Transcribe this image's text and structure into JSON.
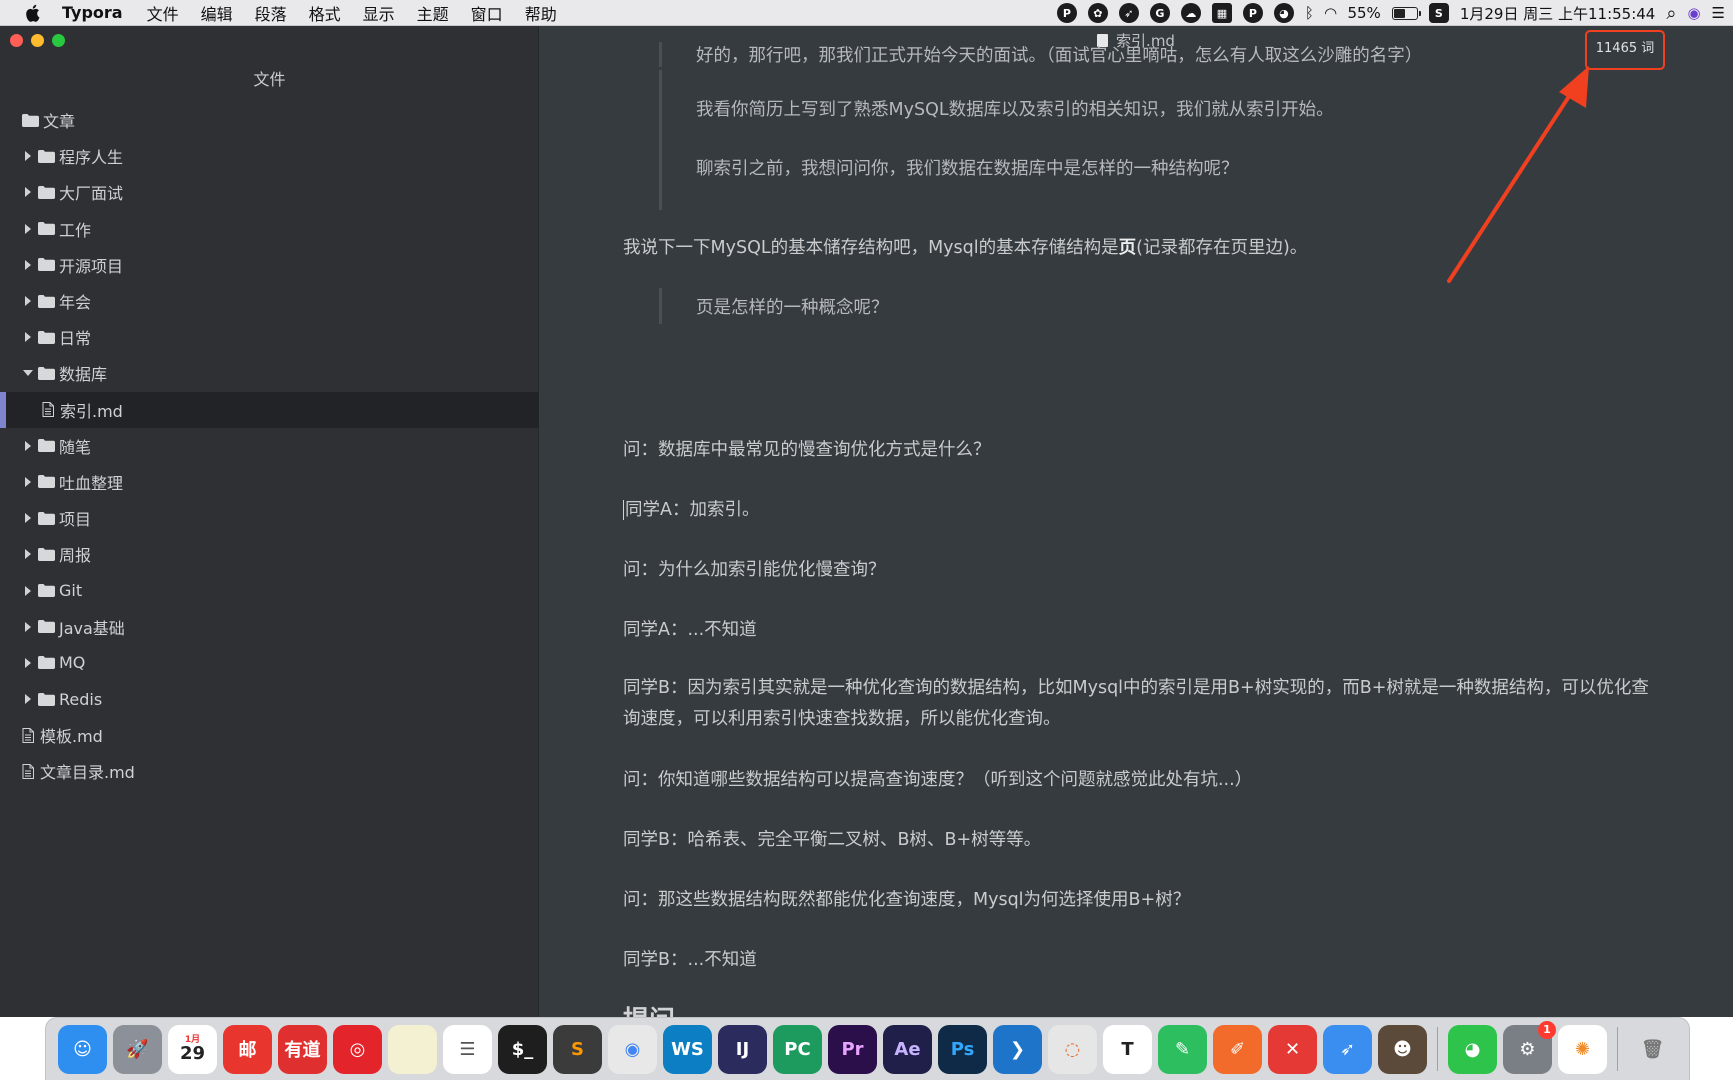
{
  "menubar": {
    "app_name": "Typora",
    "menus": [
      "文件",
      "编辑",
      "段落",
      "格式",
      "显示",
      "主题",
      "窗口",
      "帮助"
    ],
    "status_icons": [
      {
        "name": "pp-icon",
        "glyph": "P"
      },
      {
        "name": "swirl-icon",
        "glyph": "✿"
      },
      {
        "name": "rocket-status-icon",
        "glyph": "➶"
      },
      {
        "name": "grammarly-icon",
        "glyph": "G"
      },
      {
        "name": "cloud-icon",
        "glyph": "☁"
      },
      {
        "name": "grid-icon",
        "glyph": "▦"
      },
      {
        "name": "p-badge-icon",
        "glyph": "P"
      },
      {
        "name": "wechat-status-icon",
        "glyph": "◕"
      },
      {
        "name": "bluetooth-icon",
        "glyph": "ᛒ"
      },
      {
        "name": "wifi-icon",
        "glyph": "◠"
      }
    ],
    "battery_percent": "55%",
    "battery_level": 0.55,
    "scrivener_glyph": "S",
    "datetime": "1月29日 周三 上午11:55:44",
    "search_glyph": "⌕",
    "siri_glyph": "◉",
    "menu_list_glyph": "☰"
  },
  "sidebar": {
    "title": "文件",
    "tree": [
      {
        "label": "文章",
        "type": "folder",
        "depth": 0,
        "state": "none"
      },
      {
        "label": "程序人生",
        "type": "folder",
        "depth": 1,
        "state": "collapsed"
      },
      {
        "label": "大厂面试",
        "type": "folder",
        "depth": 1,
        "state": "collapsed"
      },
      {
        "label": "工作",
        "type": "folder",
        "depth": 1,
        "state": "collapsed"
      },
      {
        "label": "开源项目",
        "type": "folder",
        "depth": 1,
        "state": "collapsed"
      },
      {
        "label": "年会",
        "type": "folder",
        "depth": 1,
        "state": "collapsed"
      },
      {
        "label": "日常",
        "type": "folder",
        "depth": 1,
        "state": "collapsed"
      },
      {
        "label": "数据库",
        "type": "folder",
        "depth": 1,
        "state": "expanded"
      },
      {
        "label": "索引.md",
        "type": "file",
        "depth": 2,
        "state": "none",
        "selected": true
      },
      {
        "label": "随笔",
        "type": "folder",
        "depth": 1,
        "state": "collapsed"
      },
      {
        "label": "吐血整理",
        "type": "folder",
        "depth": 1,
        "state": "collapsed"
      },
      {
        "label": "项目",
        "type": "folder",
        "depth": 1,
        "state": "collapsed"
      },
      {
        "label": "周报",
        "type": "folder",
        "depth": 1,
        "state": "collapsed"
      },
      {
        "label": "Git",
        "type": "folder",
        "depth": 1,
        "state": "collapsed"
      },
      {
        "label": "Java基础",
        "type": "folder",
        "depth": 1,
        "state": "collapsed"
      },
      {
        "label": "MQ",
        "type": "folder",
        "depth": 1,
        "state": "collapsed"
      },
      {
        "label": "Redis",
        "type": "folder",
        "depth": 1,
        "state": "collapsed"
      },
      {
        "label": "模板.md",
        "type": "file",
        "depth": 1,
        "state": "none"
      },
      {
        "label": "文章目录.md",
        "type": "file",
        "depth": 1,
        "state": "none"
      }
    ]
  },
  "editor": {
    "doc_title": "索引.md",
    "word_count": "11465 词",
    "quote_1": "好的，那行吧，那我们正式开始今天的面试。（面试官心里嘀咕，怎么有人取这么沙雕的名字）",
    "quote_2": "我看你简历上写到了熟悉MySQL数据库以及索引的相关知识，我们就从索引开始。",
    "quote_3": "聊索引之前，我想问问你，我们数据在数据库中是怎样的一种结构呢？",
    "para_storage_a": "我说下一下MySQL的基本储存结构吧，Mysql的基本存储结构是",
    "para_storage_bold": "页",
    "para_storage_b": "(记录都存在页里边)。",
    "quote_4": "页是怎样的一种概念呢？",
    "q1": "问：数据库中最常见的慢查询优化方式是什么？",
    "a1": "同学A：加索引。",
    "q2": "问：为什么加索引能优化慢查询？",
    "a2": "同学A：...不知道",
    "b1": "同学B：因为索引其实就是一种优化查询的数据结构，比如Mysql中的索引是用B+树实现的，而B+树就是一种数据结构，可以优化查询速度，可以利用索引快速查找数据，所以能优化查询。",
    "q3": "问：你知道哪些数据结构可以提高查询速度？（听到这个问题就感觉此处有坑...）",
    "b2": "同学B：哈希表、完全平衡二叉树、B树、B+树等等。",
    "q4": "问：那这些数据结构既然都能优化查询速度，Mysql为何选择使用B+树？",
    "b3": "同学B：...不知道",
    "heading": "提问"
  },
  "dock": {
    "apps": [
      {
        "name": "finder-icon",
        "glyph": "☺",
        "color": "#2e8ff0"
      },
      {
        "name": "launchpad-icon",
        "glyph": "🚀",
        "color": "#8c9199"
      },
      {
        "name": "calendar-icon",
        "glyph": "29",
        "color": "#ffffff",
        "text_color": "#222",
        "label": "1月"
      },
      {
        "name": "mail-app-icon",
        "glyph": "邮",
        "color": "#e8352d"
      },
      {
        "name": "youdao-icon",
        "glyph": "有道",
        "color": "#e02f2f"
      },
      {
        "name": "netease-music-icon",
        "glyph": "◎",
        "color": "#e3242b"
      },
      {
        "name": "notes-icon",
        "glyph": "",
        "color": "#f4f0d2"
      },
      {
        "name": "reminders-icon",
        "glyph": "☰",
        "color": "#ffffff",
        "text_color": "#555"
      },
      {
        "name": "terminal-icon",
        "glyph": "$_",
        "color": "#1e1e1e"
      },
      {
        "name": "sublime-text-icon",
        "glyph": "S",
        "color": "#3b3b3b",
        "text_color": "#ff9800"
      },
      {
        "name": "chrome-icon",
        "glyph": "◉",
        "color": "#e8e8e8",
        "text_color": "#4285f4"
      },
      {
        "name": "webstorm-icon",
        "glyph": "WS",
        "color": "#0b7ec4"
      },
      {
        "name": "intellij-icon",
        "glyph": "IJ",
        "color": "#2b2b5e"
      },
      {
        "name": "pycharm-icon",
        "glyph": "PC",
        "color": "#1d9a5e"
      },
      {
        "name": "premiere-icon",
        "glyph": "Pr",
        "color": "#2a0f4a",
        "text_color": "#e9a3ff"
      },
      {
        "name": "after-effects-icon",
        "glyph": "Ae",
        "color": "#1f1f4a",
        "text_color": "#c8b3ff"
      },
      {
        "name": "photoshop-icon",
        "glyph": "Ps",
        "color": "#0f2a46",
        "text_color": "#31a8ff"
      },
      {
        "name": "vscode-icon",
        "glyph": "❯",
        "color": "#1e74c8"
      },
      {
        "name": "rainbow-app-icon",
        "glyph": "◌",
        "color": "#e6e6e6",
        "text_color": "#e26d2d"
      },
      {
        "name": "typora-icon",
        "glyph": "T",
        "color": "#ffffff",
        "text_color": "#222"
      },
      {
        "name": "evernote-icon",
        "glyph": "✎",
        "color": "#2dbe60"
      },
      {
        "name": "paw-icon",
        "glyph": "✐",
        "color": "#f26b2a"
      },
      {
        "name": "xmind-icon",
        "glyph": "✕",
        "color": "#e53935"
      },
      {
        "name": "rocket-app-icon",
        "glyph": "➶",
        "color": "#3a8ef0"
      },
      {
        "name": "alfred-icon",
        "glyph": "☻",
        "color": "#5b4a3a"
      }
    ],
    "system_apps": [
      {
        "name": "wechat-icon",
        "glyph": "◕",
        "color": "#2ec34a"
      },
      {
        "name": "system-preferences-icon",
        "glyph": "⚙",
        "color": "#7a7f86",
        "badge": "1"
      },
      {
        "name": "photos-icon",
        "glyph": "✺",
        "color": "#ffffff",
        "text_color": "#f08c2a"
      }
    ],
    "trash": {
      "name": "trash-icon",
      "glyph": "🗑",
      "color": "#d7d9dc",
      "text_color": "#777"
    }
  }
}
